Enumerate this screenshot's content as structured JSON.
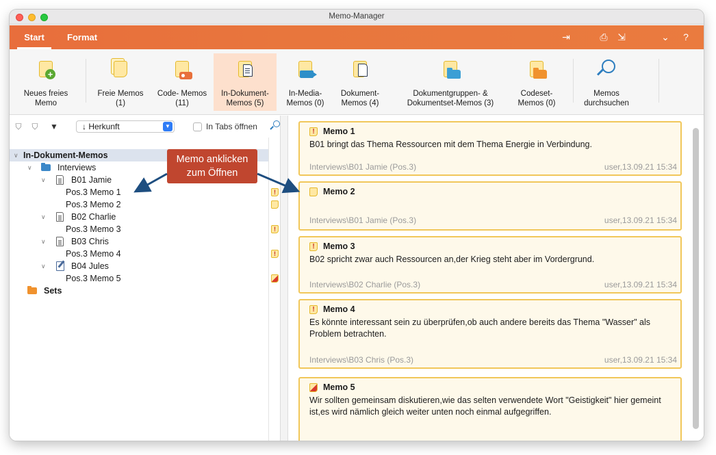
{
  "window": {
    "title": "Memo-Manager"
  },
  "tabs": {
    "start": "Start",
    "format": "Format"
  },
  "ribbon": {
    "new_free": "Neues freies\nMemo",
    "free": "Freie Memos\n(1)",
    "code": "Code- Memos\n(11)",
    "indoc": "In-Dokument-\nMemos (5)",
    "inmedia": "In-Media-\nMemos (0)",
    "doc": "Dokument-\nMemos (4)",
    "docgroup": "Dokumentgruppen- &\nDokumentset-Memos (3)",
    "codeset": "Codeset-\nMemos (0)",
    "search": "Memos\ndurchsuchen"
  },
  "left_toolbar": {
    "sort_value": "Herkunft",
    "tabs_label": "In Tabs öffnen"
  },
  "tree": {
    "root": "In-Dokument-Memos",
    "interviews": "Interviews",
    "b01": "B01 Jamie",
    "b01_m1": "Pos.3   Memo 1",
    "b01_m2": "Pos.3   Memo 2",
    "b02": "B02 Charlie",
    "b02_m3": "Pos.3   Memo 3",
    "b03": "B03 Chris",
    "b03_m4": "Pos.3   Memo 4",
    "b04": "B04 Jules",
    "b04_m5": "Pos.3   Memo 5",
    "sets": "Sets"
  },
  "callout": {
    "line1": "Memo anklicken",
    "line2": "zum Öffnen"
  },
  "memos": [
    {
      "title": "Memo 1",
      "text": "B01 bringt das Thema Ressourcen mit dem Thema Energie in Verbindung.",
      "source": "Interviews\\B01 Jamie (Pos.3)",
      "meta": "user,13.09.21 15:34"
    },
    {
      "title": "Memo 2",
      "text": "",
      "source": "Interviews\\B01 Jamie (Pos.3)",
      "meta": "user,13.09.21 15:34"
    },
    {
      "title": "Memo 3",
      "text": "B02 spricht zwar auch Ressourcen an,der Krieg steht aber im Vordergrund.",
      "source": "Interviews\\B02 Charlie (Pos.3)",
      "meta": "user,13.09.21 15:34"
    },
    {
      "title": "Memo 4",
      "text": "Es könnte interessant sein zu überprüfen,ob auch andere bereits das Thema \"Wasser\" als Problem betrachten.",
      "source": "Interviews\\B03 Chris (Pos.3)",
      "meta": "user,13.09.21 15:34"
    },
    {
      "title": "Memo 5",
      "text": "Wir sollten gemeinsam diskutieren,wie das selten verwendete Wort \"Geistigkeit\" hier gemeint ist,es wird nämlich gleich weiter unten noch einmal aufgegriffen.",
      "source": "",
      "meta": ""
    }
  ],
  "colors": {
    "accent": "#e8703b",
    "memo_border": "#f1c75a",
    "memo_bg": "#fef9ea",
    "callout": "#c0462f",
    "selection": "#dce3ee"
  }
}
